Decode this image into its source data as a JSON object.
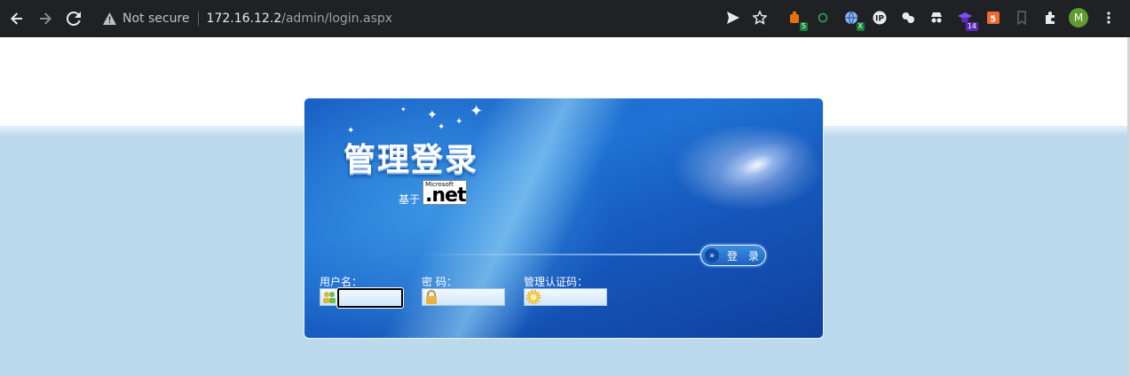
{
  "browser": {
    "security_text": "Not secure",
    "url_host": "172.16.12.2",
    "url_path": "/admin/login.aspx",
    "extensions": [
      {
        "name": "ublock-ext-icon",
        "badge": "5",
        "badge_color": "#188038",
        "color": "#e8710a"
      },
      {
        "name": "circle-ext-icon",
        "badge": "",
        "badge_color": "",
        "color": "#34a853"
      },
      {
        "name": "globe-ext-icon",
        "badge": "X",
        "badge_color": "#188038",
        "color": "#8ab4f8"
      },
      {
        "name": "ip-ext-icon",
        "badge": "",
        "badge_color": "",
        "color": "#e8eaed"
      },
      {
        "name": "cookie-ext-icon",
        "badge": "",
        "badge_color": "",
        "color": "#e8eaed"
      },
      {
        "name": "spy-ext-icon",
        "badge": "",
        "badge_color": "",
        "color": "#e8eaed"
      },
      {
        "name": "grad-cap-ext-icon",
        "badge": "14",
        "badge_color": "#5b2bb5",
        "color": "#7c4dff"
      },
      {
        "name": "html5-ext-icon",
        "badge": "",
        "badge_color": "",
        "color": "#f26a2e"
      }
    ],
    "profile_initial": "M"
  },
  "login": {
    "title": "管理登录",
    "based_on": "基于",
    "logo_top": "Microsoft",
    "logo_main": ".net",
    "button_label": "登 录",
    "username_label": "用户名：",
    "password_label": "密 码：",
    "captcha_label": "管理认证码：",
    "username_value": "",
    "password_value": "",
    "captcha_value": ""
  }
}
